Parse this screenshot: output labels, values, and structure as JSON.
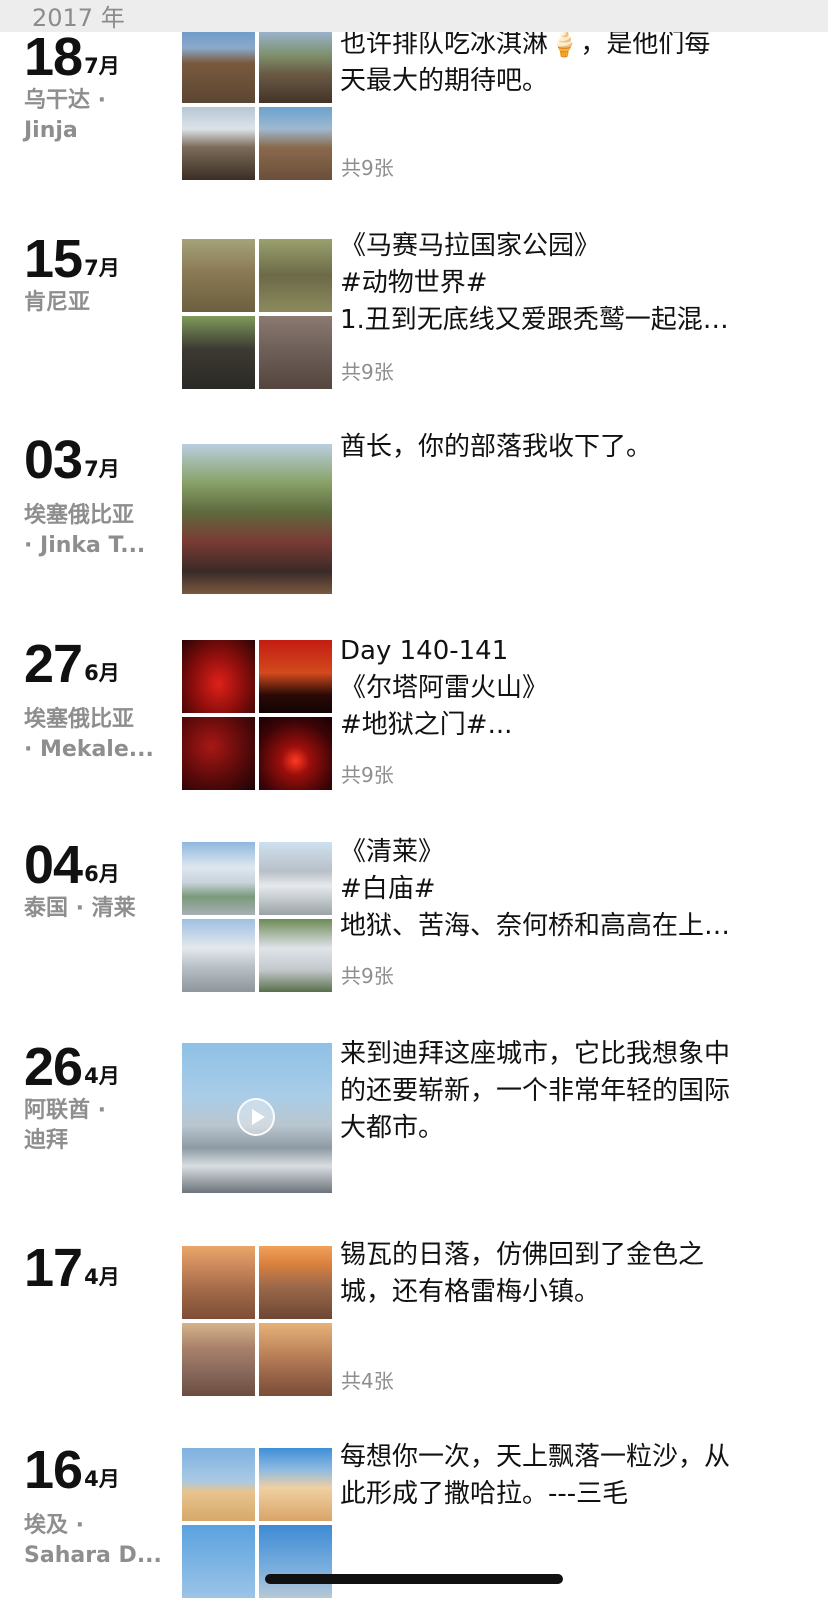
{
  "year_label": "2017 年",
  "entries": [
    {
      "day": "18",
      "month": "7月",
      "location_lines": [
        "乌干达 ·",
        "Jinja"
      ],
      "text_lines": [
        "也许排队吃冰淇淋🍦，是他们每",
        "天最大的期待吧。"
      ],
      "count": "共9张"
    },
    {
      "day": "15",
      "month": "7月",
      "location_lines": [
        "肯尼亚"
      ],
      "text_lines": [
        "《马赛马拉国家公园》",
        "#动物世界#",
        "1.丑到无底线又爱跟秃鹫一起混…"
      ],
      "count": "共9张"
    },
    {
      "day": "03",
      "month": "7月",
      "location_lines": [
        "",
        "埃塞俄比亚",
        "· Jinka T..."
      ],
      "text_lines": [
        "酋长，你的部落我收下了。"
      ],
      "count": ""
    },
    {
      "day": "27",
      "month": "6月",
      "location_lines": [
        "",
        "埃塞俄比亚",
        "· Mekale..."
      ],
      "text_lines": [
        "Day 140-141",
        "《尔塔阿雷火山》",
        "#地狱之门#..."
      ],
      "count": "共9张"
    },
    {
      "day": "04",
      "month": "6月",
      "location_lines": [
        "泰国 · 清莱"
      ],
      "text_lines": [
        "《清莱》",
        "#白庙#",
        "地狱、苦海、奈何桥和高高在上…"
      ],
      "count": "共9张"
    },
    {
      "day": "26",
      "month": "4月",
      "location_lines": [
        "阿联酋 ·",
        "迪拜"
      ],
      "text_lines": [
        "来到迪拜这座城市，它比我想象中",
        "的还要崭新，一个非常年轻的国际",
        "大都市。"
      ],
      "count": ""
    },
    {
      "day": "17",
      "month": "4月",
      "location_lines": [],
      "text_lines": [
        "锡瓦的日落，仿佛回到了金色之",
        "城，还有格雷梅小镇。"
      ],
      "count": "共4张"
    },
    {
      "day": "16",
      "month": "4月",
      "location_lines": [
        "",
        "埃及 ·",
        "Sahara D..."
      ],
      "text_lines": [
        "每想你一次，天上飘落一粒沙，从",
        "此形成了撒哈拉。---三毛"
      ],
      "count": ""
    }
  ]
}
